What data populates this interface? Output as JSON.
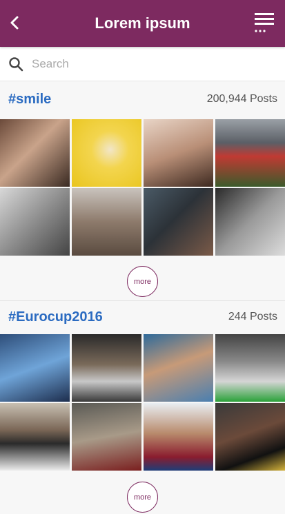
{
  "header": {
    "title": "Lorem ipsum"
  },
  "search": {
    "placeholder": "Search"
  },
  "sections": [
    {
      "tag": "#smile",
      "count": "200,944 Posts",
      "more_label": "more",
      "photos": [
        {
          "bg": "linear-gradient(135deg,#6b4a3a 0%,#c9a38a 45%,#3a2a22 100%)"
        },
        {
          "bg": "radial-gradient(circle at 55% 45%,#f2e6c8 0%,#f3d54e 35%,#e9c51d 100%)"
        },
        {
          "bg": "linear-gradient(160deg,#e8d4c6 0%,#b98f77 50%,#3d2920 100%)"
        },
        {
          "bg": "linear-gradient(180deg,#9aa0a6 0%,#5b5f66 35%,#c03a33 55%,#3b5b2b 100%)"
        },
        {
          "bg": "linear-gradient(135deg,#d8d8d8 0%,#8d8d8d 50%,#444 100%)"
        },
        {
          "bg": "linear-gradient(180deg,#c9c3bd 0%,#8d7a6b 50%,#5a4b40 100%)"
        },
        {
          "bg": "linear-gradient(135deg,#4a5a66 0%,#2c3238 45%,#7a5a48 100%)"
        },
        {
          "bg": "linear-gradient(135deg,#2a2a2a 0%,#9a9a9a 50%,#dcdcdc 100%)"
        }
      ]
    },
    {
      "tag": "#Eurocup2016",
      "count": "244 Posts",
      "more_label": "more",
      "photos": [
        {
          "bg": "linear-gradient(160deg,#2e4e7a 0%,#6fa4d8 50%,#1d2e4e 100%)"
        },
        {
          "bg": "linear-gradient(180deg,#2a2a2a 0%,#7a6a5a 45%,#c8c8c8 70%,#3a3a3a 100%)"
        },
        {
          "bg": "linear-gradient(160deg,#2f6a9a 0%,#c79a78 45%,#4a7fb0 100%)"
        },
        {
          "bg": "linear-gradient(180deg,#444 0%,#888 40%,#d5d5d5 70%,#2ba23a 100%)"
        },
        {
          "bg": "linear-gradient(180deg,#c8c0b2 0%,#7a6656 40%,#2a2a2a 60%,#ececec 100%)"
        },
        {
          "bg": "linear-gradient(170deg,#5a5a55 0%,#a89a88 50%,#7a1f1f 100%)"
        },
        {
          "bg": "linear-gradient(180deg,#e9eef2 0%,#b88a6c 45%,#8a1c2e 80%,#1f3d77 100%)"
        },
        {
          "bg": "linear-gradient(160deg,#3a3a3a 0%,#6b4a3a 45%,#111 75%,#d4b23a 100%)"
        }
      ]
    }
  ],
  "colors": {
    "header_bg": "#7d2a60",
    "tag": "#2b6bc1",
    "accent": "#7d2a60"
  }
}
